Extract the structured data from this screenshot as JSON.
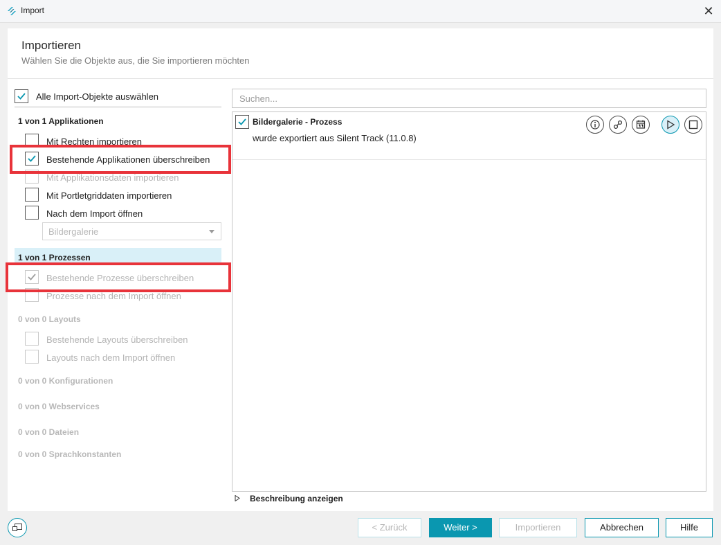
{
  "window": {
    "title": "Import",
    "close_icon": "close-icon"
  },
  "header": {
    "title": "Importieren",
    "subtitle": "Wählen Sie die Objekte aus, die Sie importieren möchten"
  },
  "left": {
    "select_all": {
      "label": "Alle Import-Objekte auswählen",
      "checked": true
    },
    "applications": {
      "heading": "1 von 1 Applikationen",
      "options": [
        {
          "label": "Mit Rechten importieren",
          "checked": false,
          "enabled": true
        },
        {
          "label": "Bestehende Applikationen überschreiben",
          "checked": true,
          "enabled": true
        },
        {
          "label": "Mit Applikationsdaten importieren",
          "checked": false,
          "enabled": false
        },
        {
          "label": "Mit Portletgriddaten importieren",
          "checked": false,
          "enabled": true
        },
        {
          "label": "Nach dem Import öffnen",
          "checked": false,
          "enabled": true
        }
      ],
      "open_select_value": "Bildergalerie"
    },
    "processes": {
      "heading": "1 von 1 Prozessen",
      "options": [
        {
          "label": "Bestehende Prozesse überschreiben",
          "checked": true,
          "enabled": false
        },
        {
          "label": "Prozesse nach dem Import öffnen",
          "checked": false,
          "enabled": false
        }
      ]
    },
    "layouts": {
      "heading": "0 von 0 Layouts",
      "options": [
        {
          "label": "Bestehende Layouts überschreiben",
          "checked": false,
          "enabled": false
        },
        {
          "label": "Layouts nach dem Import öffnen",
          "checked": false,
          "enabled": false
        }
      ]
    },
    "configurations": {
      "heading": "0 von 0 Konfigurationen"
    },
    "webservices": {
      "heading": "0 von 0 Webservices"
    },
    "files": {
      "heading": "0 von 0 Dateien"
    },
    "language_constants": {
      "heading": "0 von 0 Sprachkonstanten"
    }
  },
  "right": {
    "search": {
      "placeholder": "Suchen...",
      "value": ""
    },
    "items": [
      {
        "title": "Bildergalerie - Prozess",
        "subtitle": "wurde exportiert aus Silent Track (11.0.8)",
        "checked": true,
        "actions": [
          "info-icon",
          "link-icon",
          "calendar-icon",
          "play-icon",
          "stop-icon"
        ]
      }
    ],
    "description_toggle": "Beschreibung anzeigen"
  },
  "footer": {
    "back": "< Zurück",
    "next": "Weiter >",
    "import": "Importieren",
    "cancel": "Abbrechen",
    "help": "Hilfe"
  },
  "colors": {
    "accent": "#0a97b0",
    "highlight_red": "#e8333a",
    "section_highlight": "#d9f0f8"
  }
}
